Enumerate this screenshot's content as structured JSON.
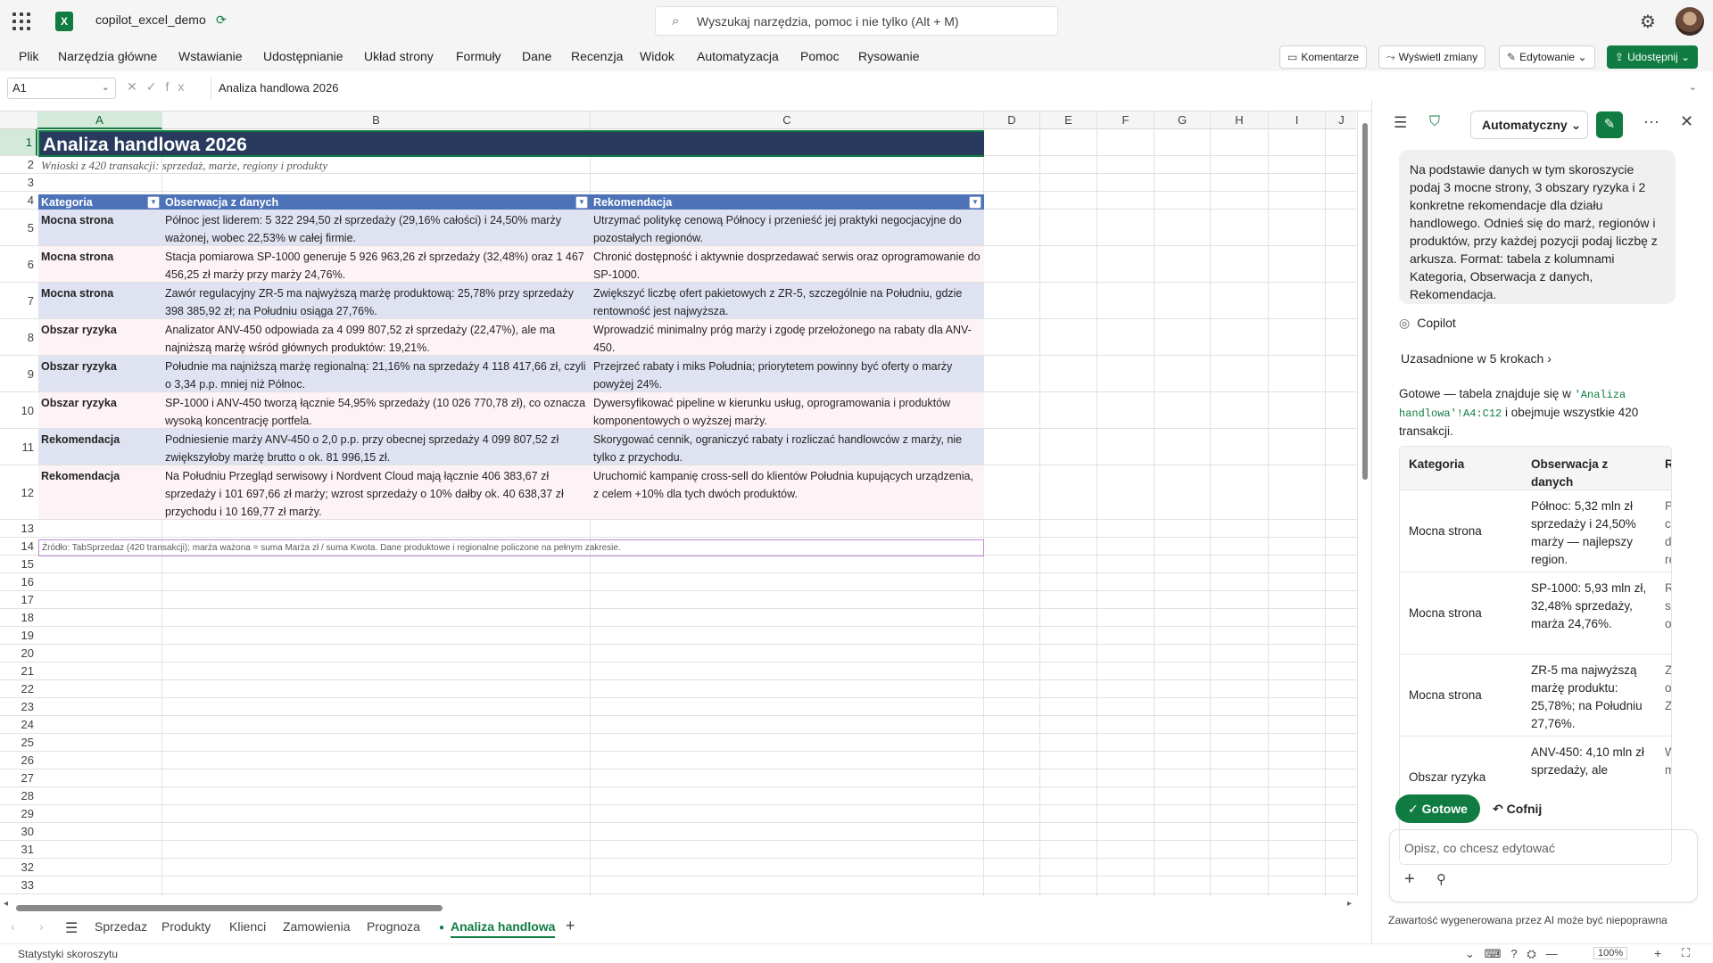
{
  "title_bar": {
    "doc_name": "copilot_excel_demo",
    "search_placeholder": "Wyszukaj narzędzia, pomoc i nie tylko (Alt + M)"
  },
  "ribbon": {
    "menus": [
      "Plik",
      "Narzędzia główne",
      "Wstawianie",
      "Udostępnianie",
      "Układ strony",
      "Formuły",
      "Dane",
      "Recenzja",
      "Widok",
      "Automatyzacja",
      "Pomoc",
      "Rysowanie"
    ],
    "comments": "Komentarze",
    "show_changes": "Wyświetl zmiany",
    "editing": "Edytowanie",
    "share": "Udostępnij"
  },
  "formula_bar": {
    "name_box": "A1",
    "formula": "Analiza handlowa 2026"
  },
  "columns": [
    "A",
    "B",
    "C",
    "D",
    "E",
    "F",
    "G",
    "H",
    "I",
    "J"
  ],
  "rows": [
    "1",
    "2",
    "3",
    "4",
    "5",
    "6",
    "7",
    "8",
    "9",
    "10",
    "11",
    "12",
    "13",
    "14",
    "15",
    "16",
    "17",
    "18",
    "19",
    "20",
    "21",
    "22",
    "23",
    "24",
    "25",
    "26",
    "27",
    "28",
    "29",
    "30",
    "31",
    "32",
    "33"
  ],
  "sheet": {
    "title": "Analiza handlowa 2026",
    "subtitle": "Wnioski z 420 transakcji: sprzedaż, marże, regiony i produkty",
    "headers": [
      "Kategoria",
      "Obserwacja z danych",
      "Rekomendacja"
    ],
    "table": [
      {
        "cat": "Mocna strona",
        "obs": "Północ jest liderem: 5 322 294,50 zł sprzedaży (29,16% całości) i 24,50% marży ważonej, wobec 22,53% w całej firmie.",
        "rec": "Utrzymać politykę cenową Północy i przenieść jej praktyki negocjacyjne do pozostałych regionów."
      },
      {
        "cat": "Mocna strona",
        "obs": "Stacja pomiarowa SP-1000 generuje 5 926 963,26 zł sprzedaży (32,48%) oraz 1 467 456,25 zł marży przy marży 24,76%.",
        "rec": "Chronić dostępność i aktywnie dosprzedawać serwis oraz oprogramowanie do SP-1000."
      },
      {
        "cat": "Mocna strona",
        "obs": "Zawór regulacyjny ZR-5 ma najwyższą marżę produktową: 25,78% przy sprzedaży 398 385,92 zł; na Południu osiąga 27,76%.",
        "rec": "Zwiększyć liczbę ofert pakietowych z ZR-5, szczególnie na Południu, gdzie rentowność jest najwyższa."
      },
      {
        "cat": "Obszar ryzyka",
        "obs": "Analizator ANV-450 odpowiada za 4 099 807,52 zł sprzedaży (22,47%), ale ma najniższą marżę wśród głównych produktów: 19,21%.",
        "rec": "Wprowadzić minimalny próg marży i zgodę przełożonego na rabaty dla ANV-450."
      },
      {
        "cat": "Obszar ryzyka",
        "obs": "Południe ma najniższą marżę regionalną: 21,16% na sprzedaży 4 118 417,66 zł, czyli o 3,34 p.p. mniej niż Północ.",
        "rec": "Przejrzeć rabaty i miks Południa; priorytetem powinny być oferty o marży powyżej 24%."
      },
      {
        "cat": "Obszar ryzyka",
        "obs": "SP-1000 i ANV-450 tworzą łącznie 54,95% sprzedaży (10 026 770,78 zł), co oznacza wysoką koncentrację portfela.",
        "rec": "Dywersyfikować pipeline w kierunku usług, oprogramowania i produktów komponentowych o wyższej marży."
      },
      {
        "cat": "Rekomendacja",
        "obs": "Podniesienie marży ANV-450 o 2,0 p.p. przy obecnej sprzedaży 4 099 807,52 zł zwiększyłoby marżę brutto o ok. 81 996,15 zł.",
        "rec": "Skorygować cennik, ograniczyć rabaty i rozliczać handlowców z marży, nie tylko z przychodu."
      },
      {
        "cat": "Rekomendacja",
        "obs": "Na Południu Przegląd serwisowy i Nordvent Cloud mają łącznie 406 383,67 zł sprzedaży i 101 697,66 zł marży; wzrost sprzedaży o 10% dałby ok. 40 638,37 zł przychodu i 10 169,77 zł marży.",
        "rec": "Uruchomić kampanię cross-sell do klientów Południa kupujących urządzenia, z celem +10% dla tych dwóch produktów."
      }
    ],
    "source": "Źródło: TabSprzedaz (420 transakcji); marża ważona = suma Marża zł / suma Kwota. Dane produktowe i regionalne policzone na pełnym zakresie."
  },
  "sheet_tabs": [
    "Sprzedaz",
    "Produkty",
    "Klienci",
    "Zamowienia",
    "Prognoza",
    "Analiza handlowa"
  ],
  "status": {
    "left": "Statystyki skoroszytu",
    "zoom": "100%"
  },
  "copilot": {
    "mode": "Automatyczny",
    "prompt": "Na podstawie danych w tym skoroszycie podaj 3 mocne strony, 3 obszary ryzyka i 2 konkretne rekomendacje dla działu handlowego. Odnieś się do marż, regionów i produktów, przy każdej pozycji podaj liczbę z arkusza. Format: tabela z kolumnami Kategoria, Obserwacja z danych, Rekomendacja.",
    "name": "Copilot",
    "reasoned": "Uzasadnione w 5 krokach",
    "reply_pre": "Gotowe — tabela znajduje się w ",
    "reply_code": "'Analiza handlowa'!A4:C12",
    "reply_post": " i obejmuje wszystkie 420 transakcji.",
    "table_headers": [
      "Kategoria",
      "Obserwacja z danych",
      "Rek"
    ],
    "table_rows": [
      {
        "cat": "Mocna strona",
        "obs": "Północ: 5,32 mln zł sprzedaży i 24,50% marży — najlepszy region.",
        "rec": "Prze cen do i regi"
      },
      {
        "cat": "Mocna strona",
        "obs": "SP-1000: 5,93 mln zł, 32,48% sprzedaży, marża 24,76%.",
        "rec": "Roz serv opr"
      },
      {
        "cat": "Mocna strona",
        "obs": "ZR-5 ma najwyższą marżę produktu: 25,78%; na Południu 27,76%.",
        "rec": "Zwi ofe z Zł"
      },
      {
        "cat": "Obszar ryzyka",
        "obs": "ANV-450: 4,10 mln zł sprzedaży, ale",
        "rec": "Wp min"
      }
    ],
    "done": "Gotowe",
    "undo": "Cofnij",
    "input_placeholder": "Opisz, co chcesz edytować",
    "disclaimer": "Zawartość wygenerowana przez AI może być niepoprawna"
  },
  "colors": {
    "accent": "#107c41",
    "title_fill": "#283a5e",
    "header_fill": "#4e72b8",
    "band_a": "#dfe3f1",
    "band_b": "#fdf3f6"
  }
}
